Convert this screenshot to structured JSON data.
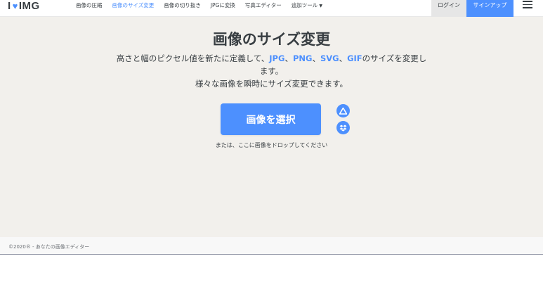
{
  "header": {
    "logo": {
      "prefix": "I",
      "heart": "♥",
      "suffix": "IMG"
    },
    "nav": [
      {
        "label": "画像の圧縮",
        "active": false
      },
      {
        "label": "画像のサイズ変更",
        "active": true
      },
      {
        "label": "画像の切り抜き",
        "active": false
      },
      {
        "label": "JPGに変換",
        "active": false
      },
      {
        "label": "写真エディター",
        "active": false
      },
      {
        "label": "追加ツール",
        "active": false,
        "icon": "caret-down-icon"
      }
    ],
    "login_label": "ログイン",
    "signup_label": "サインアップ",
    "menu_icon": "hamburger-menu-icon"
  },
  "main": {
    "title": "画像のサイズ変更",
    "desc_pre": "高さと幅のピクセル値を新たに定義して、",
    "formats": [
      "JPG",
      "PNG",
      "SVG",
      "GIF"
    ],
    "sep": "、",
    "desc_post": "のサイズを変更します。",
    "desc_line2": "様々な画像を瞬時にサイズ変更できます。",
    "select_label": "画像を選択",
    "cloud_buttons": [
      "google-drive-icon",
      "dropbox-icon"
    ],
    "drop_hint": "または、ここに画像をドロップしてください"
  },
  "footer": {
    "copyright": "©2020® - あなたの画像エディター"
  },
  "colors": {
    "accent": "#4d90fe",
    "text": "#383e42",
    "background": "#f2f0ec"
  }
}
